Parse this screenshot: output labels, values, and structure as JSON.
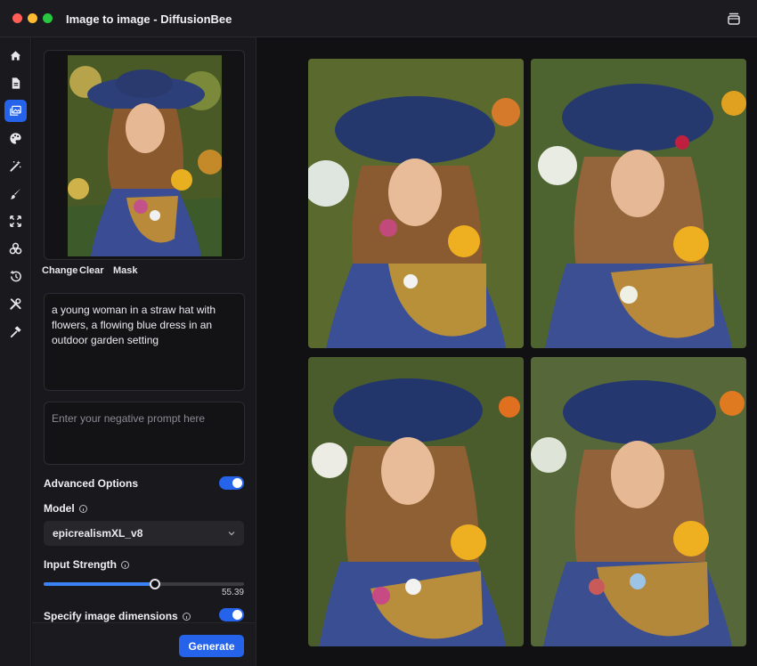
{
  "window": {
    "title": "Image to image - DiffusionBee"
  },
  "sidebar": {
    "items": [
      {
        "name": "home",
        "icon": "home-icon"
      },
      {
        "name": "text-to-image",
        "icon": "document-icon"
      },
      {
        "name": "image-to-image",
        "icon": "images-icon",
        "active": true
      },
      {
        "name": "styles",
        "icon": "palette-icon"
      },
      {
        "name": "enhance",
        "icon": "magic-wand-icon"
      },
      {
        "name": "inpaint",
        "icon": "brush-icon"
      },
      {
        "name": "upscale",
        "icon": "expand-arrows-icon"
      },
      {
        "name": "models",
        "icon": "nodes-icon"
      },
      {
        "name": "history",
        "icon": "history-icon"
      },
      {
        "name": "tools",
        "icon": "tools-icon"
      },
      {
        "name": "training",
        "icon": "hammer-icon"
      }
    ]
  },
  "input_image": {
    "actions": {
      "change": "Change",
      "clear": "Clear",
      "mask": "Mask"
    }
  },
  "prompt": {
    "value": "a young woman in a straw hat with flowers, a flowing blue dress in an outdoor garden setting"
  },
  "negative_prompt": {
    "placeholder": "Enter your negative prompt here",
    "value": ""
  },
  "options": {
    "advanced_label": "Advanced Options",
    "advanced_enabled": true,
    "model_label": "Model",
    "model_value": "epicrealismXL_v8",
    "strength_label": "Input Strength",
    "strength_value": "55.39",
    "strength_fraction": 0.5539,
    "dimensions_label": "Specify image dimensions",
    "dimensions_enabled": true
  },
  "footer": {
    "generate_label": "Generate"
  },
  "colors": {
    "accent": "#2563eb",
    "panel": "#19191d",
    "background": "#111114"
  }
}
